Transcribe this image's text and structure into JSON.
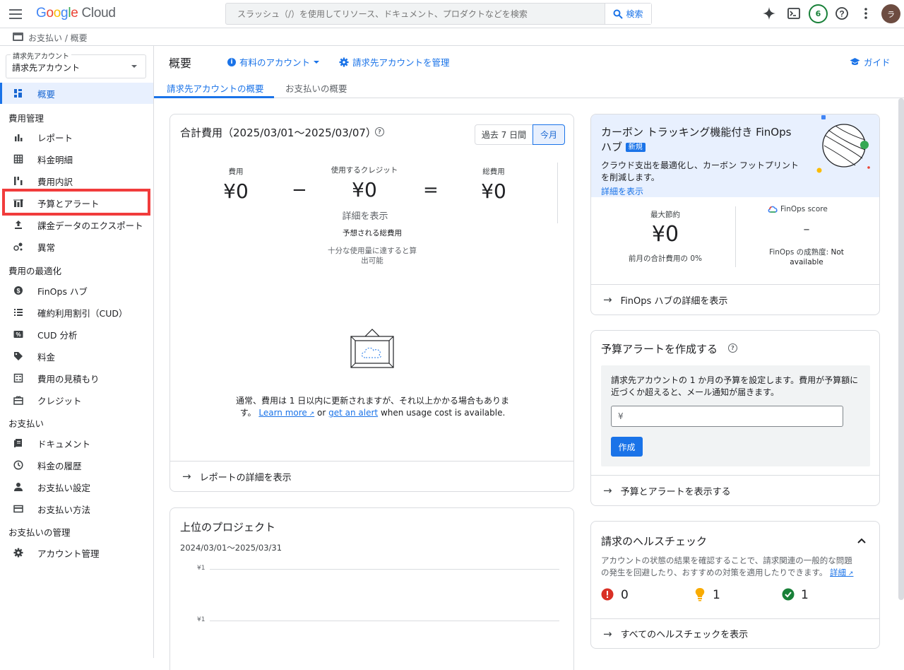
{
  "topbar": {
    "brand": {
      "g": "G",
      "o1": "o",
      "o2": "o",
      "g2": "g",
      "l": "l",
      "e": "e",
      "cloud": " Cloud"
    },
    "search_placeholder": "スラッシュ（/）を使用してリソース、ドキュメント、プロダクトなどを検索",
    "search_button": "検索",
    "notifications_count": "6",
    "avatar_initial": "ラ"
  },
  "breadcrumb": {
    "text": "お支払い  /  概要"
  },
  "sidebar": {
    "account_label": "請求先アカウント",
    "account_value": "請求先アカウント",
    "overview": "概要",
    "section_cost_mgmt": "費用管理",
    "reports": "レポート",
    "invoice": "料金明細",
    "breakdown": "費用内訳",
    "budgets": "予算とアラート",
    "export": "課金データのエクスポート",
    "anomalies": "異常",
    "section_optimization": "費用の最適化",
    "finops_hub": "FinOps ハブ",
    "cud": "確約利用割引（CUD）",
    "cud_analysis": "CUD 分析",
    "pricing": "料金",
    "estimate": "費用の見積もり",
    "credits": "クレジット",
    "section_payments": "お支払い",
    "documents": "ドキュメント",
    "history": "料金の履歴",
    "pay_settings": "お支払い設定",
    "pay_method": "お支払い方法",
    "section_admin": "お支払いの管理",
    "account_mgmt": "アカウント管理"
  },
  "header": {
    "title": "概要",
    "paid_account": "有料のアカウント",
    "manage_account": "請求先アカウントを管理",
    "guide": "ガイド"
  },
  "tabs": {
    "tab1": "請求先アカウントの概要",
    "tab2": "お支払いの概要"
  },
  "total_cost": {
    "title": "合計費用（2025/03/01〜2025/03/07）",
    "seg_7days": "過去 7 日間",
    "seg_month": "今月",
    "cost_label": "費用",
    "cost_value": "¥0",
    "credits_label": "使用するクレジット",
    "credits_value": "¥0",
    "total_label": "総費用",
    "total_value": "¥0",
    "minus": "−",
    "equals": "=",
    "details": "詳細を表示",
    "forecast_label": "予想される総費用",
    "forecast_note": "十分な使用量に達すると算出可能",
    "update_note_1": "通常、費用は 1 日以内に更新されますが、それ以上かかる場合もありま",
    "update_note_2": "す。",
    "learn_more": "Learn more",
    "or": " or ",
    "get_alert": "get an alert",
    "when_avail": " when usage cost is available.",
    "footer": "レポートの詳細を表示"
  },
  "top_projects": {
    "title": "上位のプロジェクト",
    "range": "2024/03/01〜2025/03/31",
    "tick1": "¥1",
    "tick2": "¥1"
  },
  "finops": {
    "title_1": "カーボン トラッキング機能付き FinOps",
    "title_2": "ハブ",
    "new_badge": "新規",
    "desc_1": "クラウド支出を最適化し、カーボン フットプリント",
    "desc_2": "を削減します。",
    "details": "詳細を表示",
    "max_savings_label": "最大節約",
    "max_savings_value": "¥0",
    "prev_month": "前月の合計費用の 0%",
    "score_label": "FinOps score",
    "score_value": "–",
    "maturity_1": "FinOps の成熟度: ",
    "maturity_2": "Not",
    "maturity_3": "available",
    "footer": "FinOps ハブの詳細を表示"
  },
  "budget_alert": {
    "title": "予算アラートを作成する",
    "desc_1": "請求先アカウントの 1 か月の予算を設定します。費用が予算額に",
    "desc_2": "近づくか超えると、メール通知が届きます。",
    "input_prefix": "¥",
    "create": "作成",
    "footer": "予算とアラートを表示する"
  },
  "health": {
    "title": "請求のヘルスチェック",
    "desc_1": "アカウントの状態の結果を確認することで、請求関連の一般的な問題",
    "desc_2": "の発生を回避したり、おすすめの対策を適用したりできます。",
    "details": "詳細",
    "errors": "0",
    "warnings": "1",
    "ok": "1",
    "footer": "すべてのヘルスチェックを表示"
  },
  "colors": {
    "accent": "#1a73e8",
    "highlight": "#f13c3c",
    "error": "#d93025",
    "warning": "#f9ab00",
    "ok": "#188038"
  }
}
